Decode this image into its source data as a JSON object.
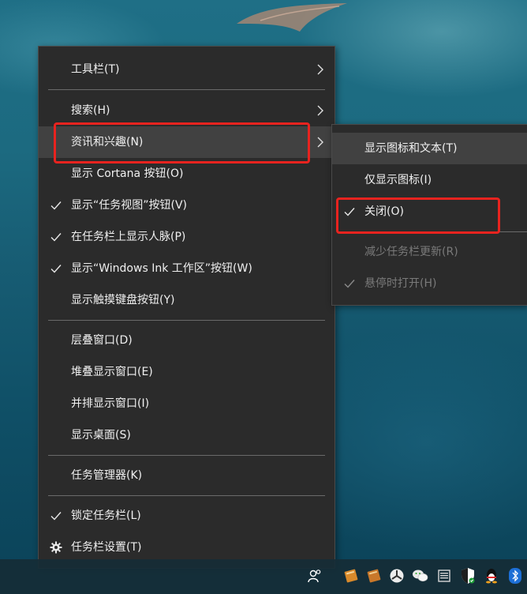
{
  "menu": {
    "items": [
      {
        "label": "工具栏(T)",
        "checked": false,
        "submenu": true
      },
      {
        "label": "搜索(H)",
        "checked": false,
        "submenu": true
      },
      {
        "label": "资讯和兴趣(N)",
        "checked": false,
        "submenu": true,
        "hovered": true
      },
      {
        "label": "显示 Cortana 按钮(O)",
        "checked": false
      },
      {
        "label": "显示“任务视图”按钮(V)",
        "checked": true
      },
      {
        "label": "在任务栏上显示人脉(P)",
        "checked": true
      },
      {
        "label": "显示“Windows Ink 工作区”按钮(W)",
        "checked": true
      },
      {
        "label": "显示触摸键盘按钮(Y)",
        "checked": false
      },
      {
        "label": "层叠窗口(D)",
        "checked": false
      },
      {
        "label": "堆叠显示窗口(E)",
        "checked": false
      },
      {
        "label": "并排显示窗口(I)",
        "checked": false
      },
      {
        "label": "显示桌面(S)",
        "checked": false
      },
      {
        "label": "任务管理器(K)",
        "checked": false
      },
      {
        "label": "锁定任务栏(L)",
        "checked": true
      },
      {
        "label": "任务栏设置(T)",
        "icon": "gear-icon"
      }
    ]
  },
  "submenu": {
    "items": [
      {
        "label": "显示图标和文本(T)",
        "hovered": true
      },
      {
        "label": "仅显示图标(I)"
      },
      {
        "label": "关闭(O)",
        "checked": true
      },
      {
        "label": "减少任务栏更新(R)",
        "disabled": true
      },
      {
        "label": "悬停时打开(H)",
        "checked": true,
        "disabled": true
      }
    ]
  },
  "taskbar": {
    "tray_icons": [
      "people-icon",
      "book-icon",
      "book-icon",
      "game-icon",
      "wechat-icon",
      "window-icon",
      "shield-icon",
      "qq-icon",
      "bluetooth-icon"
    ]
  },
  "colors": {
    "menu_bg": "#2b2b2b",
    "hover_bg": "#414141",
    "highlight_box": "#e8231f",
    "disabled_text": "#7a7a7a"
  }
}
